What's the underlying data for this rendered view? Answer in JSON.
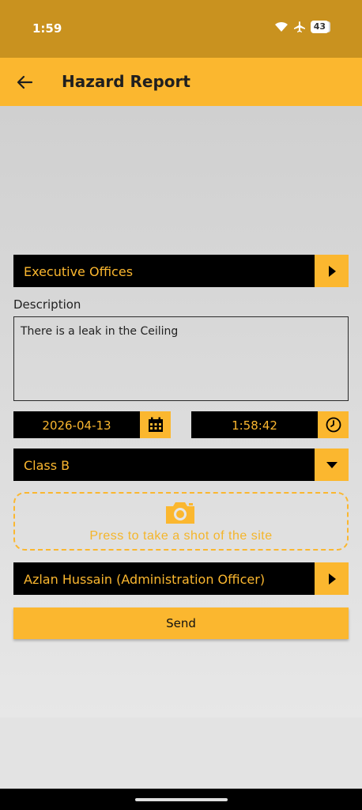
{
  "status_bar": {
    "time": "1:59",
    "battery": "43"
  },
  "app_bar": {
    "title": "Hazard Report"
  },
  "location": {
    "value": "Executive Offices"
  },
  "description": {
    "label": "Description",
    "value": "There is a leak in the Ceiling"
  },
  "date": {
    "value": "2026-04-13"
  },
  "time": {
    "value": "1:58:42"
  },
  "hazard_class": {
    "value": "Class B"
  },
  "photo": {
    "prompt": "Press to take a shot of the site"
  },
  "assignee": {
    "value": "Azlan Hussain (Administration Officer)"
  },
  "send": {
    "label": "Send"
  },
  "colors": {
    "accent": "#fbb72f",
    "status_bar": "#c9921f",
    "field_bg": "#000000"
  }
}
